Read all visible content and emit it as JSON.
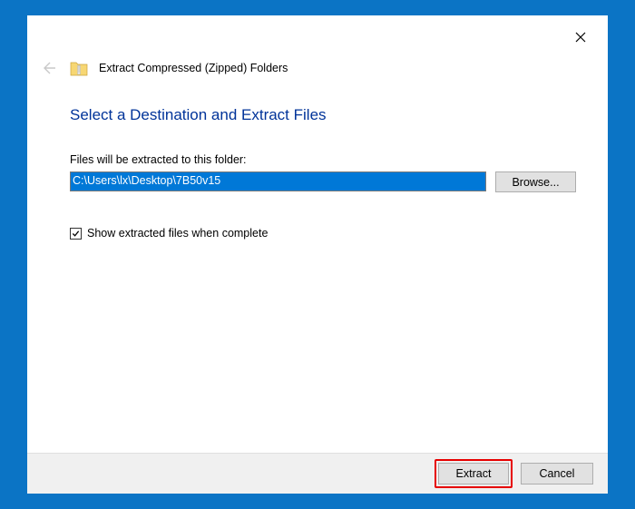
{
  "window": {
    "title": "Extract Compressed (Zipped) Folders"
  },
  "heading": "Select a Destination and Extract Files",
  "path_label": "Files will be extracted to this folder:",
  "path_value": "C:\\Users\\lx\\Desktop\\7B50v15",
  "browse_label": "Browse...",
  "checkbox": {
    "label": "Show extracted files when complete",
    "checked": true
  },
  "buttons": {
    "extract": "Extract",
    "cancel": "Cancel"
  }
}
